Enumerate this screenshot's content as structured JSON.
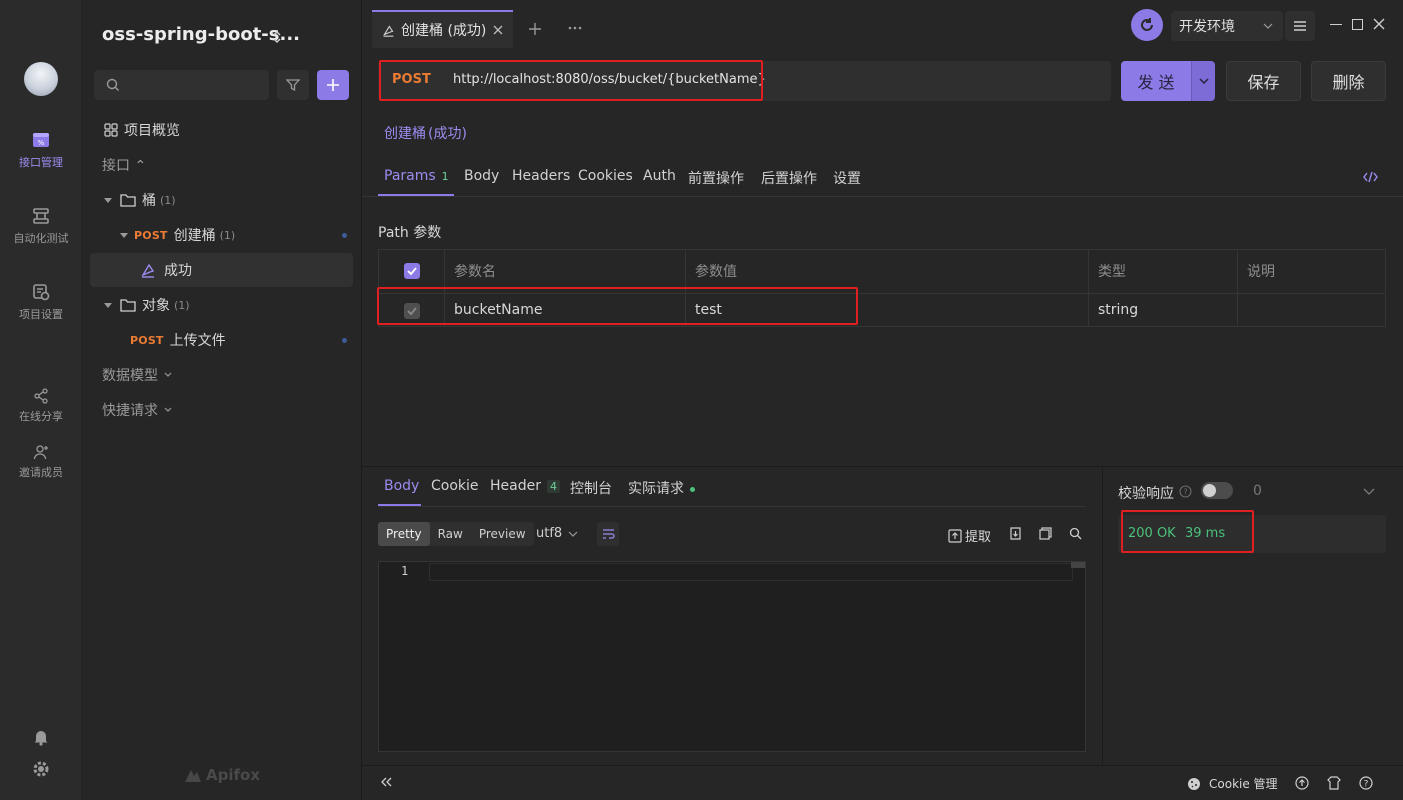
{
  "rail": {
    "items": [
      {
        "label": "接口管理",
        "icon": "api-management-icon"
      },
      {
        "label": "自动化测试",
        "icon": "automation-icon"
      },
      {
        "label": "项目设置",
        "icon": "project-settings-icon"
      },
      {
        "label": "在线分享",
        "icon": "share-icon"
      },
      {
        "label": "邀请成员",
        "icon": "invite-member-icon"
      }
    ],
    "accent": "#9c8cf0"
  },
  "tree": {
    "project_name": "oss-spring-boot-s...",
    "overview": "项目概览",
    "api_section": "接口 ⌃",
    "folder_bucket": "桶",
    "folder_bucket_count": "(1)",
    "api_create_bucket_method": "POST",
    "api_create_bucket": "创建桶",
    "api_create_bucket_count": "(1)",
    "case_success": "成功",
    "folder_object": "对象",
    "folder_object_count": "(1)",
    "api_upload_method": "POST",
    "api_upload": "上传文件",
    "data_models": "数据模型",
    "quick_requests": "快捷请求",
    "brand": "Apifox"
  },
  "header": {
    "tab_label": "创建桶 (成功)",
    "environment": "开发环境",
    "env_icon_color": "#8c7ae6"
  },
  "request": {
    "method": "POST",
    "url": "http://localhost:8080/oss/bucket/{bucketName}",
    "send_label": "发 送",
    "save_label": "保存",
    "delete_label": "删除",
    "title": "创建桶",
    "title_suffix": "(成功)"
  },
  "req_tabs": {
    "params": "Params",
    "params_count": "1",
    "body": "Body",
    "headers": "Headers",
    "cookies": "Cookies",
    "auth": "Auth",
    "pre": "前置操作",
    "post": "后置操作",
    "settings": "设置"
  },
  "path_params": {
    "section_title": "Path 参数",
    "headers": {
      "name": "参数名",
      "value": "参数值",
      "type": "类型",
      "desc": "说明"
    },
    "rows": [
      {
        "name": "bucketName",
        "value": "test",
        "type": "string",
        "desc": ""
      }
    ]
  },
  "response": {
    "tabs": {
      "body": "Body",
      "cookie": "Cookie",
      "header": "Header",
      "header_count": "4",
      "console": "控制台",
      "actual": "实际请求"
    },
    "formats": {
      "pretty": "Pretty",
      "raw": "Raw",
      "preview": "Preview"
    },
    "encoding": "utf8",
    "extract": "提取",
    "line_number": "1",
    "validate_label": "校验响应",
    "validate_count": "0",
    "status": "200 OK",
    "time": "39 ms",
    "status_color": "#4bc17b"
  },
  "footer": {
    "cookie_manage": "Cookie 管理"
  }
}
